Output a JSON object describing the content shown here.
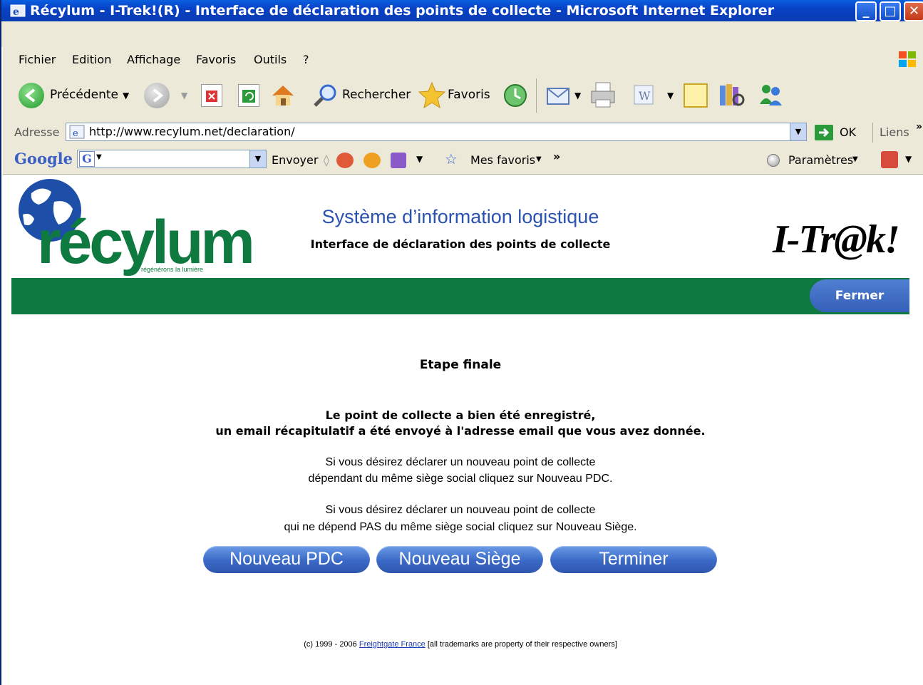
{
  "window": {
    "title": "Récylum - I-Trek!(R) - Interface de déclaration des points de collecte - Microsoft Internet Explorer"
  },
  "menu": [
    "Fichier",
    "Edition",
    "Affichage",
    "Favoris",
    "Outils",
    "?"
  ],
  "toolbar": {
    "back": "Précédente",
    "search": "Rechercher",
    "favorites": "Favoris"
  },
  "address": {
    "label": "Adresse",
    "url": "http://www.recylum.net/declaration/",
    "go": "OK",
    "links": "Liens",
    "chevron": "»"
  },
  "google": {
    "logo": "Google",
    "send": "Envoyer",
    "bookmarks": "Mes favoris",
    "chevron": "»",
    "settings": "Paramètres"
  },
  "header": {
    "logo_text": "récylum",
    "logo_tagline": "régénérons la lumière",
    "title": "Système d’information logistique",
    "subtitle": "Interface de déclaration des points de collecte",
    "brand": "I-Tr@k!"
  },
  "nav": {
    "close": "Fermer"
  },
  "content": {
    "step": "Etape finale",
    "confirm_line1": "Le point de collecte a bien été enregistré,",
    "confirm_line2": "un email récapitulatif a été envoyé à l'adresse email que vous avez donnée.",
    "info1_line1": "Si vous désirez déclarer un nouveau point de collecte",
    "info1_line2": "dépendant du même siège social cliquez sur Nouveau PDC.",
    "info2_line1": "Si vous désirez déclarer un nouveau point de collecte",
    "info2_line2": "qui ne dépend PAS du même siège social cliquez sur Nouveau Siège."
  },
  "buttons": {
    "new_pdc": "Nouveau PDC",
    "new_siege": "Nouveau Siège",
    "finish": "Terminer"
  },
  "footer": {
    "prefix": "(c) 1999 - 2006",
    "link": "Freightgate France",
    "suffix": "[all trademarks are property of their respective owners]"
  },
  "colors": {
    "green_bar": "#0f7a40",
    "title_blue": "#2a52b0",
    "button_blue": "#3a69c6"
  }
}
